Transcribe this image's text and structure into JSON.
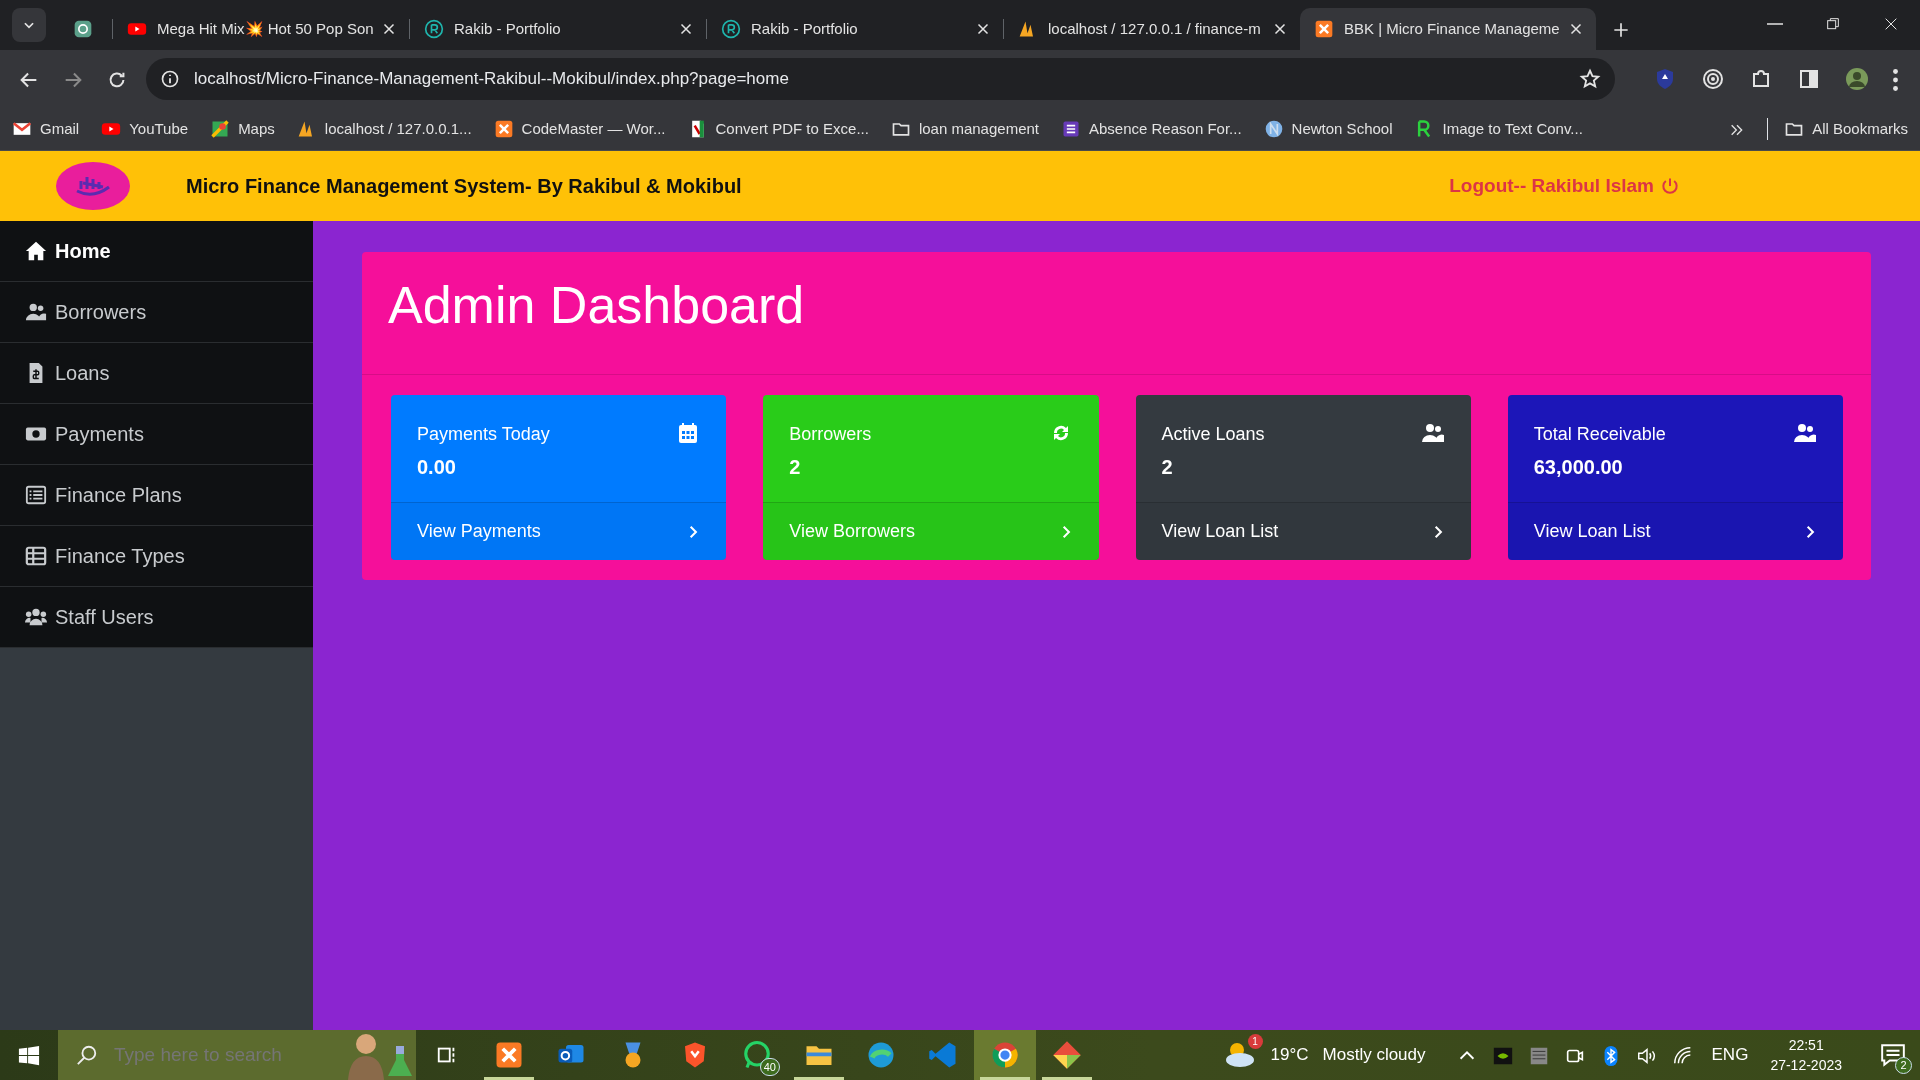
{
  "browser": {
    "tabs": [
      {
        "selected": false
      },
      {
        "title": "Mega Hit Mix💥 Hot 50 Pop Son",
        "selected": false
      },
      {
        "title": "Rakib - Portfolio",
        "selected": false
      },
      {
        "title": "Rakib - Portfolio",
        "selected": false
      },
      {
        "title": "localhost / 127.0.0.1 / finance-m",
        "selected": false
      },
      {
        "title": "BBK | Micro Finance Manageme",
        "selected": true
      }
    ],
    "address": "localhost/Micro-Finance-Management-Rakibul--Mokibul/index.php?page=home",
    "bookmarks": [
      "Gmail",
      "YouTube",
      "Maps",
      "localhost / 127.0.0.1...",
      "CodeMaster — Wor...",
      "Convert PDF to Exce...",
      "loan management",
      "Absence Reason For...",
      "Newton School",
      "Image to Text Conv..."
    ],
    "all_bookmarks": "All Bookmarks"
  },
  "header": {
    "title": "Micro Finance Management System- By Rakibul & Mokibul",
    "logout": "Logout-- Rakibul Islam"
  },
  "sidebar": {
    "items": [
      {
        "label": "Home",
        "selected": true
      },
      {
        "label": "Borrowers",
        "selected": false
      },
      {
        "label": "Loans",
        "selected": false
      },
      {
        "label": "Payments",
        "selected": false
      },
      {
        "label": "Finance Plans",
        "selected": false
      },
      {
        "label": "Finance Types",
        "selected": false
      },
      {
        "label": "Staff Users",
        "selected": false
      }
    ]
  },
  "dashboard": {
    "title": "Admin Dashboard",
    "cards": [
      {
        "label": "Payments Today",
        "value": "0.00",
        "link": "View Payments",
        "color": "#007bff"
      },
      {
        "label": "Borrowers",
        "value": "2",
        "link": "View Borrowers",
        "color": "#29cc19"
      },
      {
        "label": "Active Loans",
        "value": "2",
        "link": "View Loan List",
        "color": "#343a40"
      },
      {
        "label": "Total Receivable",
        "value": "63,000.00",
        "link": "View Loan List",
        "color": "#1c16b8"
      }
    ]
  },
  "taskbar": {
    "search_placeholder": "Type here to search",
    "apps": [
      {
        "running": true,
        "selected": false
      },
      {
        "running": false,
        "selected": false
      },
      {
        "running": false,
        "selected": false
      },
      {
        "running": false,
        "selected": false
      },
      {
        "running": false,
        "selected": false,
        "badge": "40"
      },
      {
        "running": true,
        "selected": false
      },
      {
        "running": false,
        "selected": false
      },
      {
        "running": false,
        "selected": false
      },
      {
        "running": true,
        "selected": true
      },
      {
        "running": true,
        "selected": false
      }
    ],
    "weather_badge": "1",
    "temperature": "19°C",
    "weather": "Mostly cloudy",
    "language": "ENG",
    "time": "22:51",
    "date": "27-12-2023",
    "notifications": "2"
  }
}
